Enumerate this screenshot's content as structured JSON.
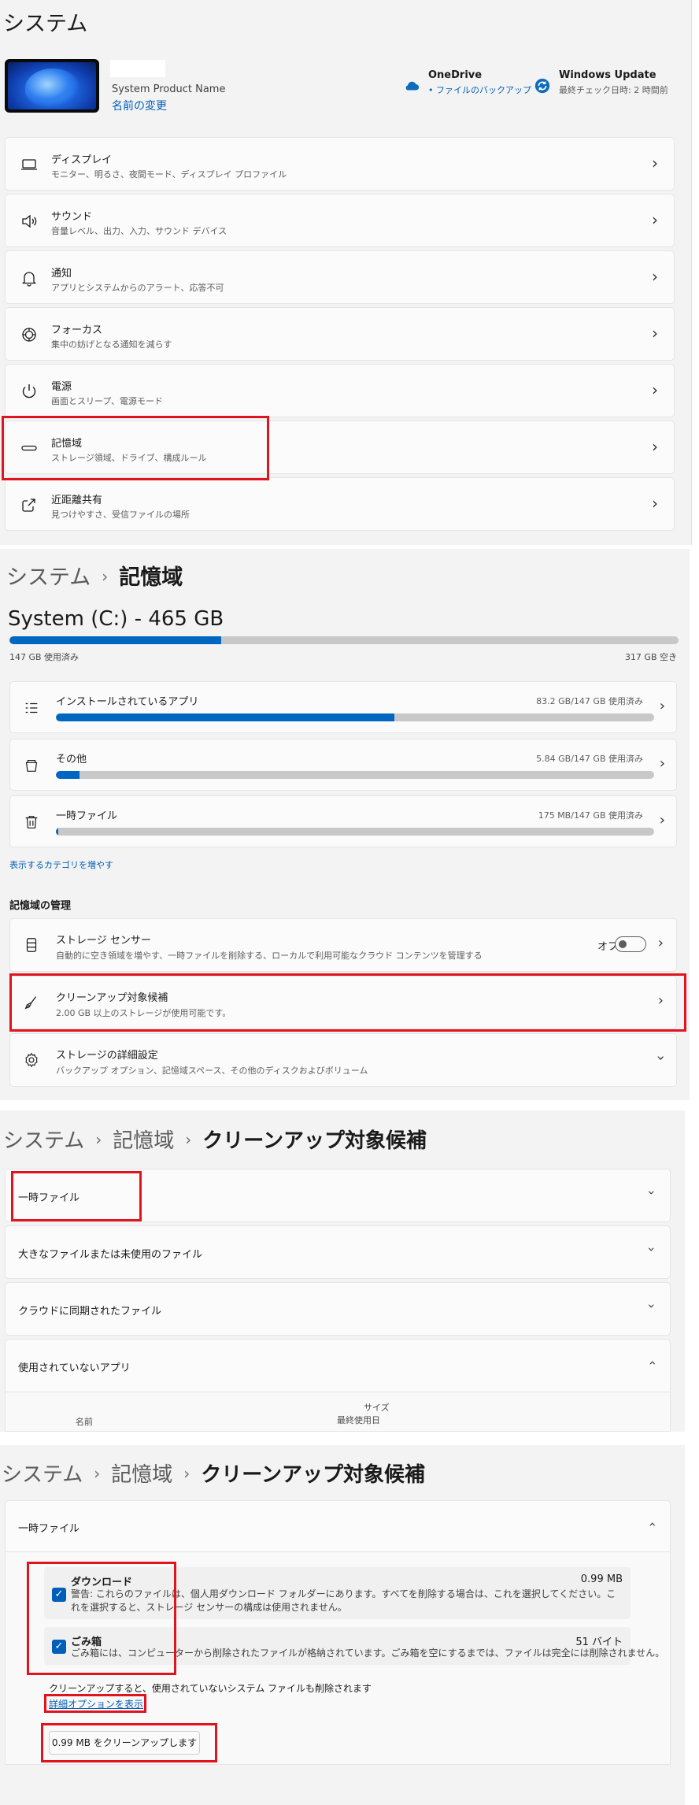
{
  "panel1": {
    "title": "システム",
    "device": {
      "model": "System Product Name",
      "rename_link": "名前の変更"
    },
    "onedrive": {
      "title": "OneDrive",
      "subtitle": "• ファイルのバックアップ",
      "icon": "cloud-icon"
    },
    "windows_update": {
      "title": "Windows Update",
      "subtitle": "最終チェック日時: 2 時間前",
      "icon": "sync-icon"
    },
    "items": [
      {
        "title": "ディスプレイ",
        "subtitle": "モニター、明るさ、夜間モード、ディスプレイ プロファイル",
        "icon": "display-icon"
      },
      {
        "title": "サウンド",
        "subtitle": "音量レベル、出力、入力、サウンド デバイス",
        "icon": "speaker-icon"
      },
      {
        "title": "通知",
        "subtitle": "アプリとシステムからのアラート、応答不可",
        "icon": "bell-icon"
      },
      {
        "title": "フォーカス",
        "subtitle": "集中の妨げとなる通知を減らす",
        "icon": "focus-icon"
      },
      {
        "title": "電源",
        "subtitle": "画面とスリープ、電源モード",
        "icon": "power-icon"
      },
      {
        "title": "記憶域",
        "subtitle": "ストレージ領域、ドライブ、構成ルール",
        "icon": "storage-icon"
      },
      {
        "title": "近距離共有",
        "subtitle": "見つけやすさ、受信ファイルの場所",
        "icon": "share-icon"
      }
    ]
  },
  "panel2": {
    "breadcrumb": [
      "システム",
      "記憶域"
    ],
    "volume_title": "System (C:) - 465 GB",
    "volume_used_label": "147 GB 使用済み",
    "volume_free_label": "317 GB 空き",
    "volume_used_fraction": 0.316,
    "categories": [
      {
        "title": "インストールされているアプリ",
        "value": "83.2 GB/147 GB 使用済み",
        "fraction": 0.566,
        "icon": "apps-list-icon"
      },
      {
        "title": "その他",
        "value": "5.84 GB/147 GB 使用済み",
        "fraction": 0.04,
        "icon": "folder-icon"
      },
      {
        "title": "一時ファイル",
        "value": "175 MB/147 GB 使用済み",
        "fraction": 0.004,
        "icon": "trash-icon"
      }
    ],
    "show_more_link": "表示するカテゴリを増やす",
    "management_heading": "記憶域の管理",
    "management": [
      {
        "title": "ストレージ センサー",
        "subtitle": "自動的に空き領域を増やす、一時ファイルを削除する、ローカルで利用可能なクラウド コンテンツを管理する",
        "icon": "storage-sense-icon",
        "toggle_label": "オフ"
      },
      {
        "title": "クリーンアップ対象候補",
        "subtitle": "2.00 GB 以上のストレージが使用可能です。",
        "icon": "broom-icon"
      },
      {
        "title": "ストレージの詳細設定",
        "subtitle": "バックアップ オプション、記憶域スペース、その他のディスクおよびボリューム",
        "icon": "gear-icon"
      }
    ]
  },
  "panel3": {
    "breadcrumb": [
      "システム",
      "記憶域",
      "クリーンアップ対象候補"
    ],
    "sections": [
      {
        "title": "一時ファイル"
      },
      {
        "title": "大きなファイルまたは未使用のファイル"
      },
      {
        "title": "クラウドに同期されたファイル"
      },
      {
        "title": "使用されていないアプリ"
      }
    ],
    "columns": {
      "name": "名前",
      "size": "サイズ",
      "last_used": "最終使用日"
    }
  },
  "panel4": {
    "breadcrumb": [
      "システム",
      "記憶域",
      "クリーンアップ対象候補"
    ],
    "section_title": "一時ファイル",
    "files": [
      {
        "name": "ダウンロード",
        "size": "0.99 MB",
        "description": "警告: これらのファイルは、個人用ダウンロード フォルダーにあります。すべてを削除する場合は、これを選択してください。これを選択すると、ストレージ センサーの構成は使用されません。",
        "checked": true
      },
      {
        "name": "ごみ箱",
        "size": "51 バイト",
        "description": "ごみ箱には、コンピューターから削除されたファイルが格納されています。ごみ箱を空にするまでは、ファイルは完全には削除されません。",
        "checked": true
      }
    ],
    "note": "クリーンアップすると、使用されていないシステム ファイルも削除されます",
    "advanced_link": "詳細オプションを表示",
    "cleanup_button": "0.99 MB をクリーンアップします"
  },
  "colors": {
    "accent": "#0067c0",
    "highlight": "#e0141e",
    "card": "#fbfbfb",
    "background": "#f3f3f3"
  }
}
